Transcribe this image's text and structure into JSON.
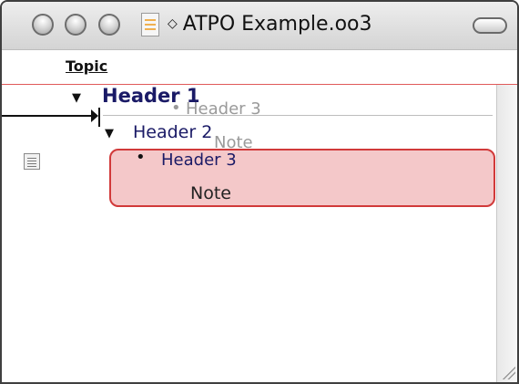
{
  "window": {
    "title_prefix": "◇",
    "title": "ATPO Example.oo3"
  },
  "outline": {
    "column_header": "Topic",
    "rows": [
      {
        "label": "Header 1"
      },
      {
        "label": "Header 2"
      },
      {
        "label": "Header 3",
        "note": "Note"
      }
    ],
    "drag_ghost": {
      "label": "Header 3",
      "note": "Note"
    }
  },
  "icons": {
    "expanded_triangle": "▼",
    "bullet": "•"
  }
}
